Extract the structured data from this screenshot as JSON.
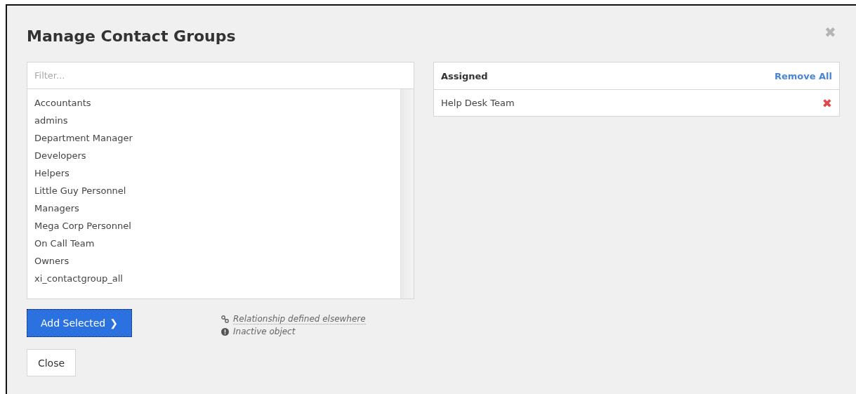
{
  "dialog": {
    "title": "Manage Contact Groups",
    "close_icon": "✖"
  },
  "available": {
    "filter": {
      "placeholder": "Filter..."
    },
    "items": [
      {
        "label": "Accountants",
        "selected": false
      },
      {
        "label": "admins",
        "selected": false
      },
      {
        "label": "Department Manager",
        "selected": false
      },
      {
        "label": "Developers",
        "selected": false
      },
      {
        "label": "Helpers",
        "selected": false
      },
      {
        "label": "Little Guy Personnel",
        "selected": false
      },
      {
        "label": "Managers",
        "selected": false
      },
      {
        "label": "Mega Corp Personnel",
        "selected": false
      },
      {
        "label": "On Call Team",
        "selected": false
      },
      {
        "label": "Owners",
        "selected": false
      },
      {
        "label": "xi_contactgroup_all",
        "selected": false
      }
    ]
  },
  "add_button": {
    "label": "Add Selected",
    "caret": "❯"
  },
  "legend": [
    {
      "kind": "link",
      "text": "Relationship defined elsewhere"
    },
    {
      "kind": "inactive",
      "text": "Inactive object"
    }
  ],
  "close_button": {
    "label": "Close"
  },
  "assigned": {
    "title": "Assigned",
    "remove_all": "Remove All",
    "items": [
      {
        "label": "Help Desk Team",
        "remove_icon": "✖"
      }
    ]
  }
}
